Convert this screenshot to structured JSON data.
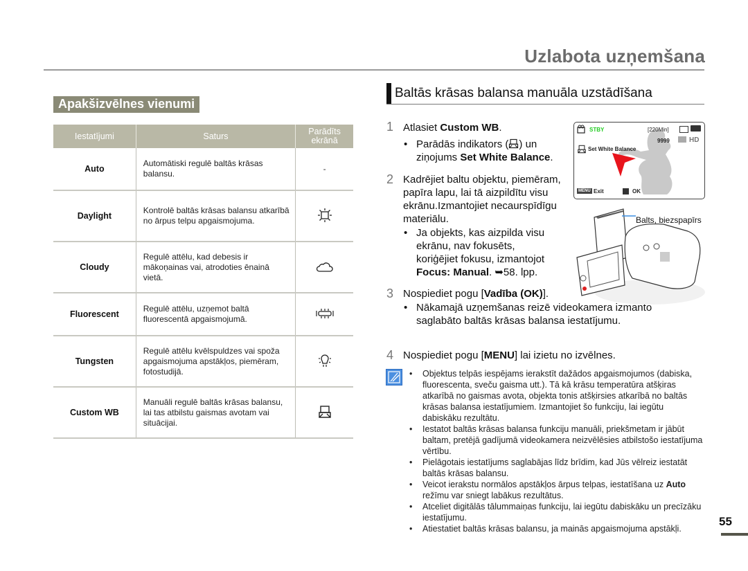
{
  "header": {
    "title": "Uzlabota uzņemšana"
  },
  "left": {
    "section_label": "Apakšizvēlnes vienumi",
    "table": {
      "columns": [
        "Iestatījumi",
        "Saturs",
        "Parādīts ekrānā"
      ],
      "column_3_lines": [
        "Parādīts",
        "ekrānā"
      ],
      "rows": [
        {
          "setting": "Auto",
          "description": "Automātiski regulē baltās krāsas balansu.",
          "display": "-",
          "icon": "none"
        },
        {
          "setting": "Daylight",
          "description": "Kontrolē baltās krāsas balansu atkarībā no ārpus telpu apgaismojuma.",
          "display": "",
          "icon": "sun-icon"
        },
        {
          "setting": "Cloudy",
          "description": "Regulē attēlu, kad debesis ir mākoņainas vai, atrodoties ēnainā vietā.",
          "display": "",
          "icon": "cloud-icon"
        },
        {
          "setting": "Fluorescent",
          "description": "Regulē attēlu, uzņemot baltā fluorescentā apgaismojumā.",
          "display": "",
          "icon": "fluorescent-icon"
        },
        {
          "setting": "Tungsten",
          "description": "Regulē attēlu kvēlspuldzes vai spoža apgaismojuma apstākļos, piemēram, fotostudijā.",
          "display": "",
          "icon": "tungsten-bulb-icon"
        },
        {
          "setting": "Custom WB",
          "description": "Manuāli regulē baltās krāsas balansu, lai tas atbilstu gaismas avotam vai situācijai.",
          "display": "",
          "icon": "custom-wb-icon"
        }
      ]
    }
  },
  "right": {
    "heading": "Baltās krāsas balansa manuāla uzstādīšana",
    "steps": [
      {
        "num": "1",
        "text_pre": "Atlasiet ",
        "text_bold": "Custom WB",
        "text_post": ".",
        "bullet_pre": "Parādās indikators (",
        "bullet_mid": ") un ziņojums ",
        "bullet_bold": "Set White Balance",
        "bullet_post": "."
      },
      {
        "num": "2",
        "text": "Kadrējiet baltu objektu, piemēram, papīra lapu, lai tā aizpildītu visu ekrānu.Izmantojiet necaurspīdīgu materiālu.",
        "bullet_pre": "Ja objekts, kas aizpilda visu ekrānu, nav fokusēts, koriģējiet fokusu, izmantojot ",
        "bullet_bold": "Focus: Manual",
        "bullet_post": ". ➥58. lpp."
      },
      {
        "num": "3",
        "text_pre": "Nospiediet pogu [",
        "text_bold": "Vadība (OK)",
        "text_post": "].",
        "bullet": "Nākamajā uzņemšanas reizē videokamera izmanto saglabāto baltās krāsas balansa iestatījumu."
      },
      {
        "num": "4",
        "text_pre": "Nospiediet pogu [",
        "text_bold": "MENU",
        "text_post": "] lai izietu no izvēlnes."
      }
    ],
    "lcd": {
      "mode": "STBY",
      "remaining": "[220Min]",
      "count": "9999",
      "quality": "HD",
      "message": "Set White Balance",
      "exit_key": "MENU",
      "exit_label": "Exit",
      "ok_label": "OK",
      "mode_color": "#22cc22",
      "arrow_color": "#e8141c"
    },
    "paper_label": "Balts, biezspapīrs",
    "notes": [
      {
        "text": "Objektus telpās iespējams ierakstīt dažādos apgaismojumos (dabiska, fluorescenta, sveču gaisma utt.). Tā kā krāsu temperatūra atšķiras atkarībā no gaismas avota, objekta tonis atšķirsies atkarībā no baltās krāsas balansa iestatījumiem. Izmantojiet šo funkciju, lai iegūtu dabiskāku rezultātu."
      },
      {
        "text": "Iestatot baltās krāsas balansa funkciju manuāli, priekšmetam ir jābūt baltam, pretējā gadījumā videokamera neizvēlēsies atbilstošo iestatījuma vērtību."
      },
      {
        "text": "Pielāgotais iestatījums saglabājas līdz brīdim, kad Jūs vēlreiz iestatāt baltās krāsas balansu."
      },
      {
        "text_bold_prefix_pre": "Veicot ierakstu normālos apstākļos ārpus telpas, iestatīšana uz ",
        "text_bold": "Auto",
        "text_post": " režīmu var sniegt labākus rezultātus."
      },
      {
        "text": "Atceliet digitālās tālummaiņas funkciju, lai iegūtu dabiskāku un precīzāku iestatījumu."
      },
      {
        "text": "Atiestatiet baltās krāsas balansu, ja mainās apgaismojuma apstākļi."
      }
    ]
  },
  "footer": {
    "page_number": "55"
  },
  "colors": {
    "section_label_bg": "#8a8a76",
    "table_header_bg": "#b9b8a6",
    "note_icon": "#4b8fe0"
  }
}
